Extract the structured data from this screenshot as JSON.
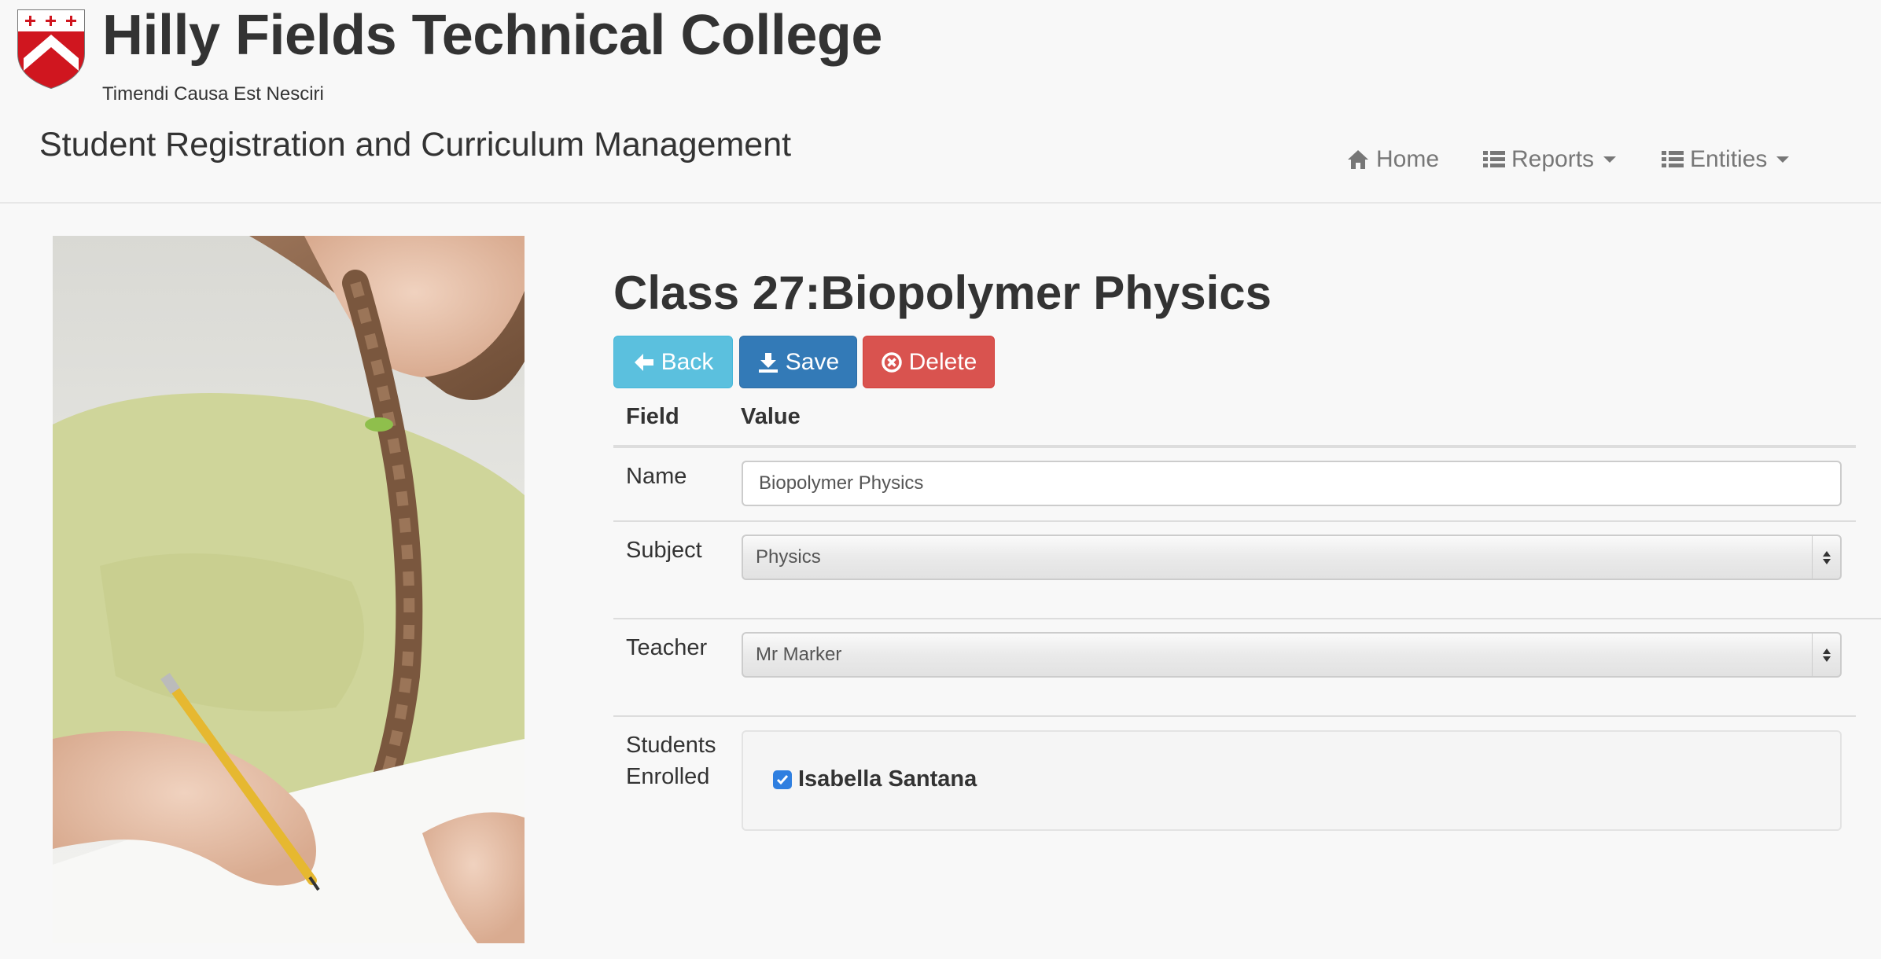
{
  "header": {
    "college_name": "Hilly Fields Technical College",
    "motto": "Timendi Causa Est Nesciri",
    "app_title": "Student Registration and Curriculum Management"
  },
  "nav": {
    "home": "Home",
    "reports": "Reports",
    "entities": "Entities"
  },
  "page": {
    "title": "Class 27:Biopolymer Physics"
  },
  "buttons": {
    "back": "Back",
    "save": "Save",
    "delete": "Delete"
  },
  "table": {
    "field_header": "Field",
    "value_header": "Value"
  },
  "fields": {
    "name_label": "Name",
    "name_value": "Biopolymer Physics",
    "subject_label": "Subject",
    "subject_value": "Physics",
    "teacher_label": "Teacher",
    "teacher_value": "Mr Marker",
    "students_label_line1": "Students",
    "students_label_line2": "Enrolled",
    "students": [
      {
        "name": "Isabella Santana",
        "checked": true
      }
    ]
  },
  "colors": {
    "back": "#5bc0de",
    "save": "#337ab7",
    "delete": "#d9534f",
    "crest_red": "#d0161f"
  },
  "icons": {
    "home": "home-icon",
    "reports": "list-icon",
    "entities": "list-icon",
    "back": "arrow-left-icon",
    "save": "download-icon",
    "delete": "remove-circle-icon"
  }
}
